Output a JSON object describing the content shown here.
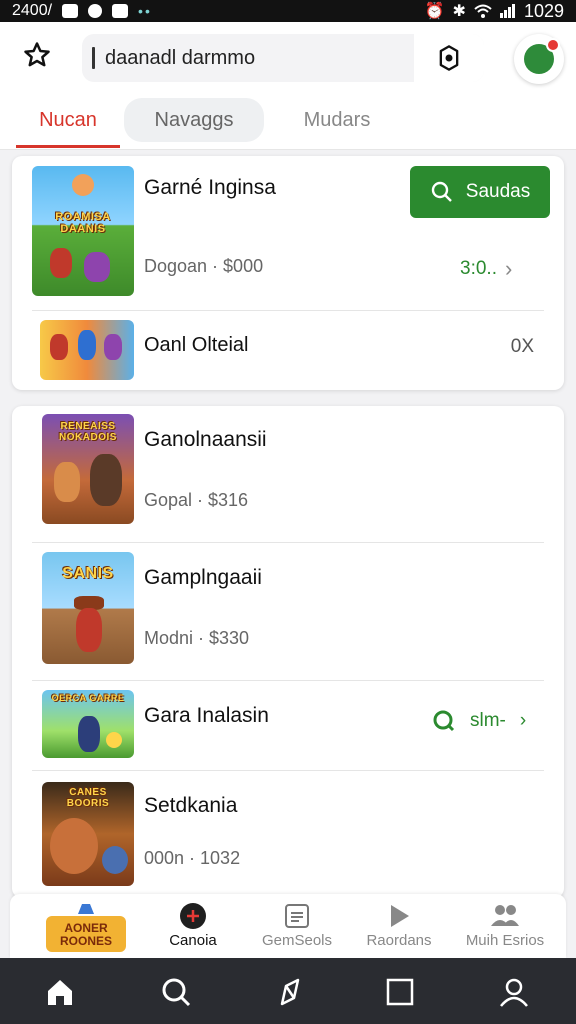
{
  "status_bar": {
    "left_text": "2400/",
    "time": "1029"
  },
  "search": {
    "query": "daanadl darmmo"
  },
  "tabs": [
    {
      "label": "Nucan",
      "active": true
    },
    {
      "label": "Navaggs",
      "active": false
    },
    {
      "label": "Mudars",
      "active": false
    }
  ],
  "featured": {
    "title": "Garné Inginsa",
    "subtitle": "Dogoan · $000",
    "thumb_text": "ROAMISA DAANIS",
    "get_button_label": "Saudas",
    "price_link_text": "3:0..",
    "sub_item": {
      "title": "Oanl Olteial",
      "size": "0X"
    }
  },
  "list": [
    {
      "title": "Ganolnaansii",
      "subtitle": "Gopal · $316",
      "thumb_text": "RENEAISS NOKADOIS"
    },
    {
      "title": "Gamplngaaii",
      "subtitle": "Modni · $330",
      "thumb_text": "SANIS"
    },
    {
      "title": "Gara Inalasin",
      "subtitle": "",
      "thumb_text": "OERCA GARRE",
      "price_chip": "slm-"
    },
    {
      "title": "Setdkania",
      "subtitle": "000n · 1032",
      "thumb_text": "CANES BOORIS"
    }
  ],
  "categories": [
    {
      "label": "",
      "logo_text": "AONER ROONES"
    },
    {
      "label": "Canoia",
      "active": true
    },
    {
      "label": "GemSeols"
    },
    {
      "label": "Raordans"
    },
    {
      "label": "Muih Esrios"
    }
  ],
  "colors": {
    "accent_red": "#d7352b",
    "accent_green": "#2b8a2f"
  }
}
